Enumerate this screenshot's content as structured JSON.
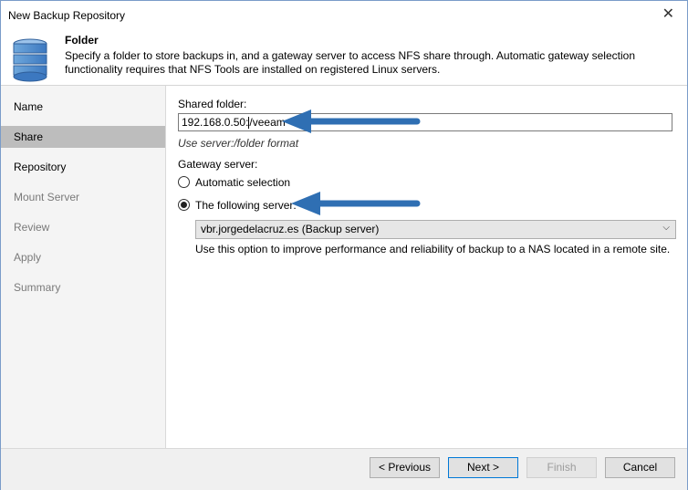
{
  "window": {
    "title": "New Backup Repository",
    "close_glyph": "✕"
  },
  "header": {
    "title": "Folder",
    "description": "Specify a folder to store backups in, and a gateway server to access NFS share through. Automatic gateway selection functionality requires that NFS Tools are installed on registered Linux servers.",
    "icon": "database-icon"
  },
  "nav": {
    "items": [
      {
        "label": "Name",
        "state": "normal"
      },
      {
        "label": "Share",
        "state": "active"
      },
      {
        "label": "Repository",
        "state": "normal"
      },
      {
        "label": "Mount Server",
        "state": "disabled"
      },
      {
        "label": "Review",
        "state": "disabled"
      },
      {
        "label": "Apply",
        "state": "disabled"
      },
      {
        "label": "Summary",
        "state": "disabled"
      }
    ]
  },
  "share": {
    "shared_folder_label": "Shared folder:",
    "shared_folder_value_a": "192.168.0.50:",
    "shared_folder_value_b": "/veeam",
    "format_hint": "Use server:/folder format",
    "gateway_label": "Gateway server:",
    "automatic_label": "Automatic selection",
    "following_label": "The following server:",
    "selected_option": "following",
    "server_value": "vbr.jorgedelacruz.es (Backup server)",
    "server_note": "Use this option to improve performance and reliability of backup to a NAS located in a remote site."
  },
  "footer": {
    "previous": "< Previous",
    "next": "Next >",
    "finish": "Finish",
    "cancel": "Cancel"
  },
  "colors": {
    "annotation_arrow": "#2f6fb3",
    "active_nav": "#bdbdbd",
    "primary_border": "#0078d7"
  }
}
